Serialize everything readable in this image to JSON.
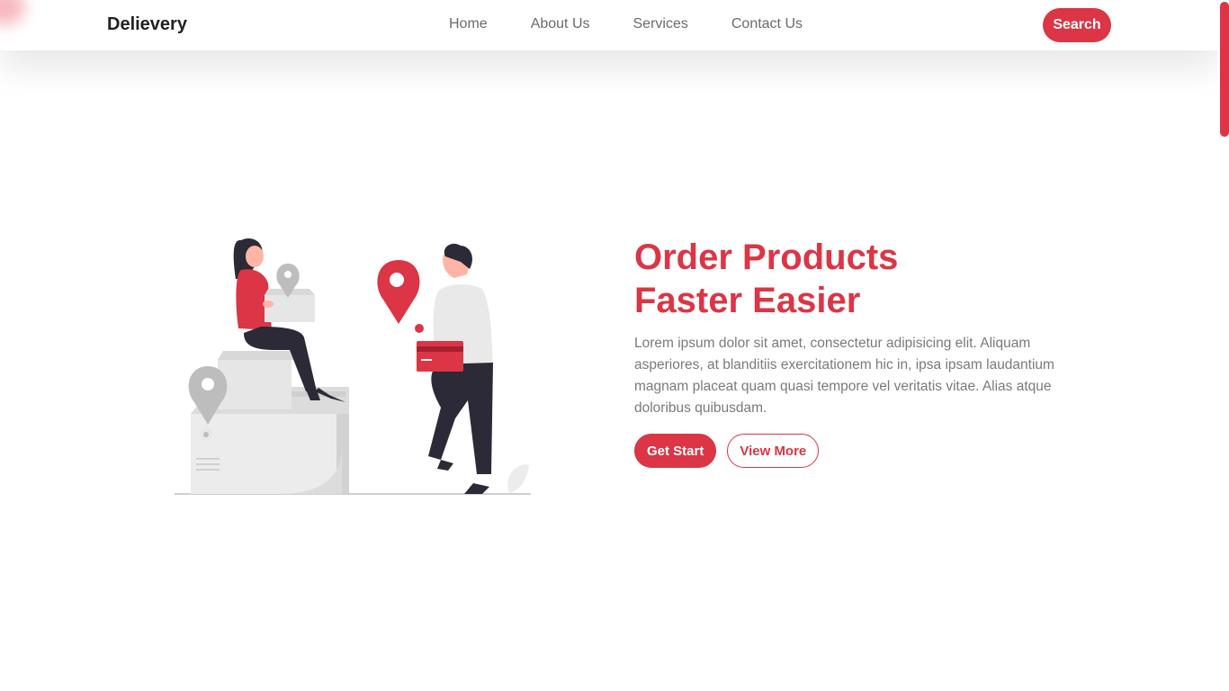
{
  "header": {
    "brand": "Delievery",
    "nav": [
      "Home",
      "About Us",
      "Services",
      "Contact Us"
    ],
    "search_label": "Search"
  },
  "hero": {
    "title_line1": "Order Products",
    "title_line2": "Faster Easier",
    "description": "Lorem ipsum dolor sit amet, consectetur adipisicing elit. Aliquam asperiores, at blanditiis exercitationem hic in, ipsa ipsam laudantium magnam placeat quam quasi tempore vel veritatis vitae. Alias atque doloribus quibusdam.",
    "primary_button": "Get Start",
    "secondary_button": "View More"
  },
  "illustration": {
    "name": "delivery-illustration",
    "icons": [
      "location-pin-icon",
      "package-box-icon",
      "credit-card-icon",
      "person-icon"
    ]
  },
  "colors": {
    "accent": "#dc3545",
    "text_muted": "#7a7a7a",
    "brand_text": "#222222"
  }
}
